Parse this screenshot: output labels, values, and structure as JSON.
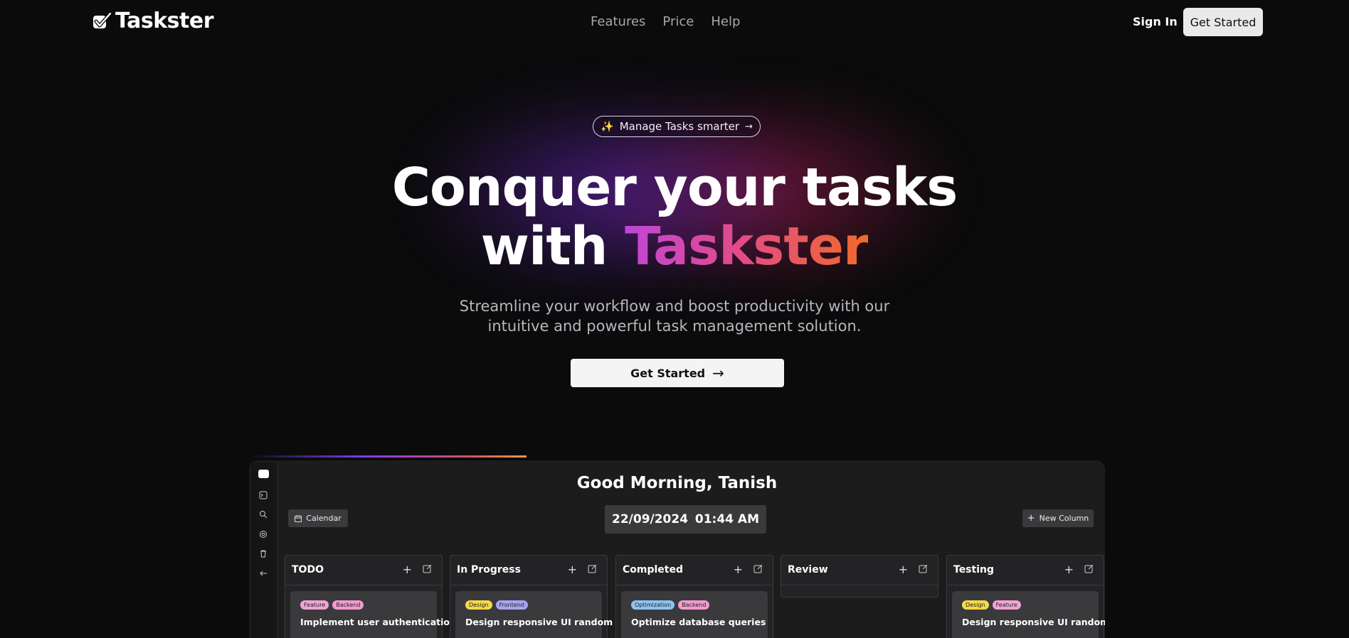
{
  "nav": {
    "brand": "Taskster",
    "links": [
      "Features",
      "Price",
      "Help"
    ],
    "sign_in": "Sign In",
    "get_started": "Get Started"
  },
  "hero": {
    "pill_text": "Manage Tasks smarter",
    "headline_line1": "Conquer your tasks",
    "headline_line2_prefix": "with",
    "headline_line2_brand": "Taskster",
    "subtitle_line1": "Streamline your workflow and boost productivity with our",
    "subtitle_line2": "intuitive and powerful task management solution.",
    "cta": "Get Started"
  },
  "app": {
    "greeting": "Good Morning, Tanish",
    "calendar_label": "Calendar",
    "date": "22/09/2024",
    "time": "01:44 AM",
    "new_column_label": "New Column",
    "columns": [
      {
        "title": "TODO",
        "card": {
          "tags": [
            {
              "label": "Feature",
              "color": "#f2a3d6"
            },
            {
              "label": "Backend",
              "color": "#f29ad0"
            }
          ],
          "title": "Implement user authentication"
        }
      },
      {
        "title": "In Progress",
        "card": {
          "tags": [
            {
              "label": "Design",
              "color": "#f5d94a"
            },
            {
              "label": "Frontend",
              "color": "#a7a5f2"
            }
          ],
          "title": "Design responsive UI random"
        }
      },
      {
        "title": "Completed",
        "card": {
          "tags": [
            {
              "label": "Optimization",
              "color": "#8cc4f2"
            },
            {
              "label": "Backend",
              "color": "#f29ad0"
            }
          ],
          "title": "Optimize database queries"
        }
      },
      {
        "title": "Review",
        "card": null
      },
      {
        "title": "Testing",
        "card": {
          "tags": [
            {
              "label": "Design",
              "color": "#f5d94a"
            },
            {
              "label": "Feature",
              "color": "#f2a3d6"
            }
          ],
          "title": "Design responsive UI random"
        }
      }
    ]
  }
}
